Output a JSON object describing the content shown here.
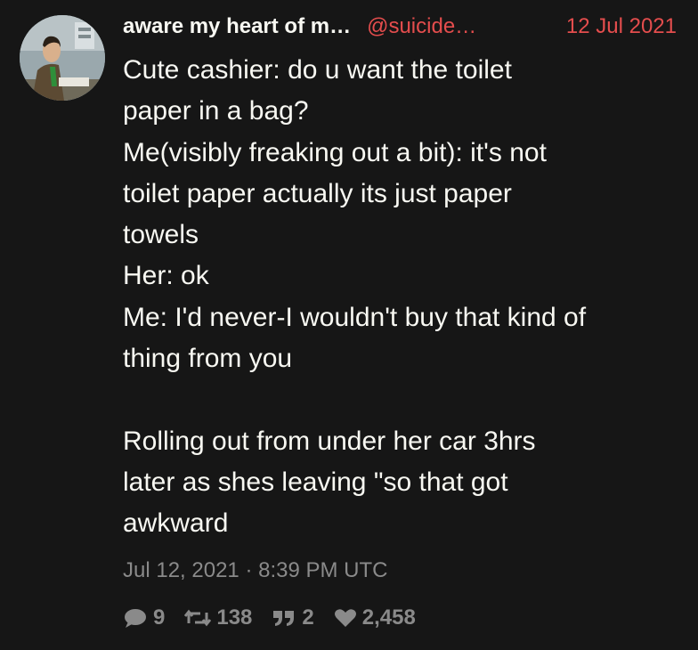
{
  "tweet": {
    "fullname": "aware my heart of m…",
    "username": "@suicide…",
    "date": "12 Jul 2021",
    "content_lines": [
      "Cute cashier: do u want the toilet",
      "paper in a bag?",
      "Me(visibly freaking out a bit): it's not",
      "toilet paper actually its just paper",
      "towels",
      "Her: ok",
      "Me: I'd never-I wouldn't buy that kind of",
      "thing from you",
      "Rolling out from under her car 3hrs",
      "later as shes leaving \"so that got",
      "awkward"
    ],
    "published": "Jul 12, 2021 · 8:39 PM UTC",
    "stats": {
      "replies": "9",
      "retweets": "138",
      "quotes": "2",
      "likes": "2,458"
    }
  },
  "colors": {
    "background": "#161616",
    "text": "#f8f8f2",
    "accent": "#e44d4d",
    "muted": "#8a8a8a"
  },
  "icons": {
    "replies": "comment-icon",
    "retweets": "retweet-icon",
    "quotes": "quote-icon",
    "likes": "heart-icon"
  }
}
